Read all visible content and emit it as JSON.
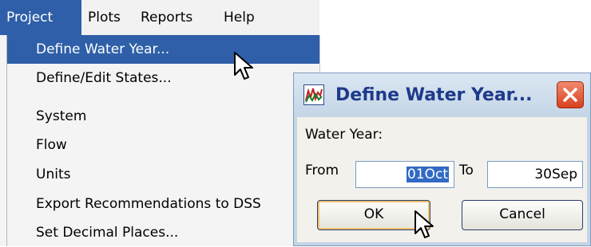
{
  "menubar": {
    "items": [
      {
        "label": "Project",
        "active": true
      },
      {
        "label": "Plots",
        "active": false
      },
      {
        "label": "Reports",
        "active": false
      },
      {
        "label": "Help",
        "active": false
      }
    ]
  },
  "project_menu": {
    "items": [
      {
        "label": "Define Water Year...",
        "highlighted": true
      },
      {
        "label": "Define/Edit States..."
      },
      {
        "label": "System"
      },
      {
        "label": "Flow"
      },
      {
        "label": "Units"
      },
      {
        "label": "Export Recommendations to DSS"
      },
      {
        "label": "Set Decimal Places..."
      }
    ]
  },
  "dialog": {
    "title": "Define Water Year...",
    "water_year_label": "Water Year:",
    "from_label": "From",
    "from_value": "01Oct",
    "to_label": "To",
    "to_value": "30Sep",
    "ok_label": "OK",
    "cancel_label": "Cancel"
  },
  "colors": {
    "menu_highlight": "#2e5fa8",
    "dialog_frame": "#c4d5e6",
    "dialog_title": "#1f3a8a",
    "close_button": "#d9401f"
  }
}
